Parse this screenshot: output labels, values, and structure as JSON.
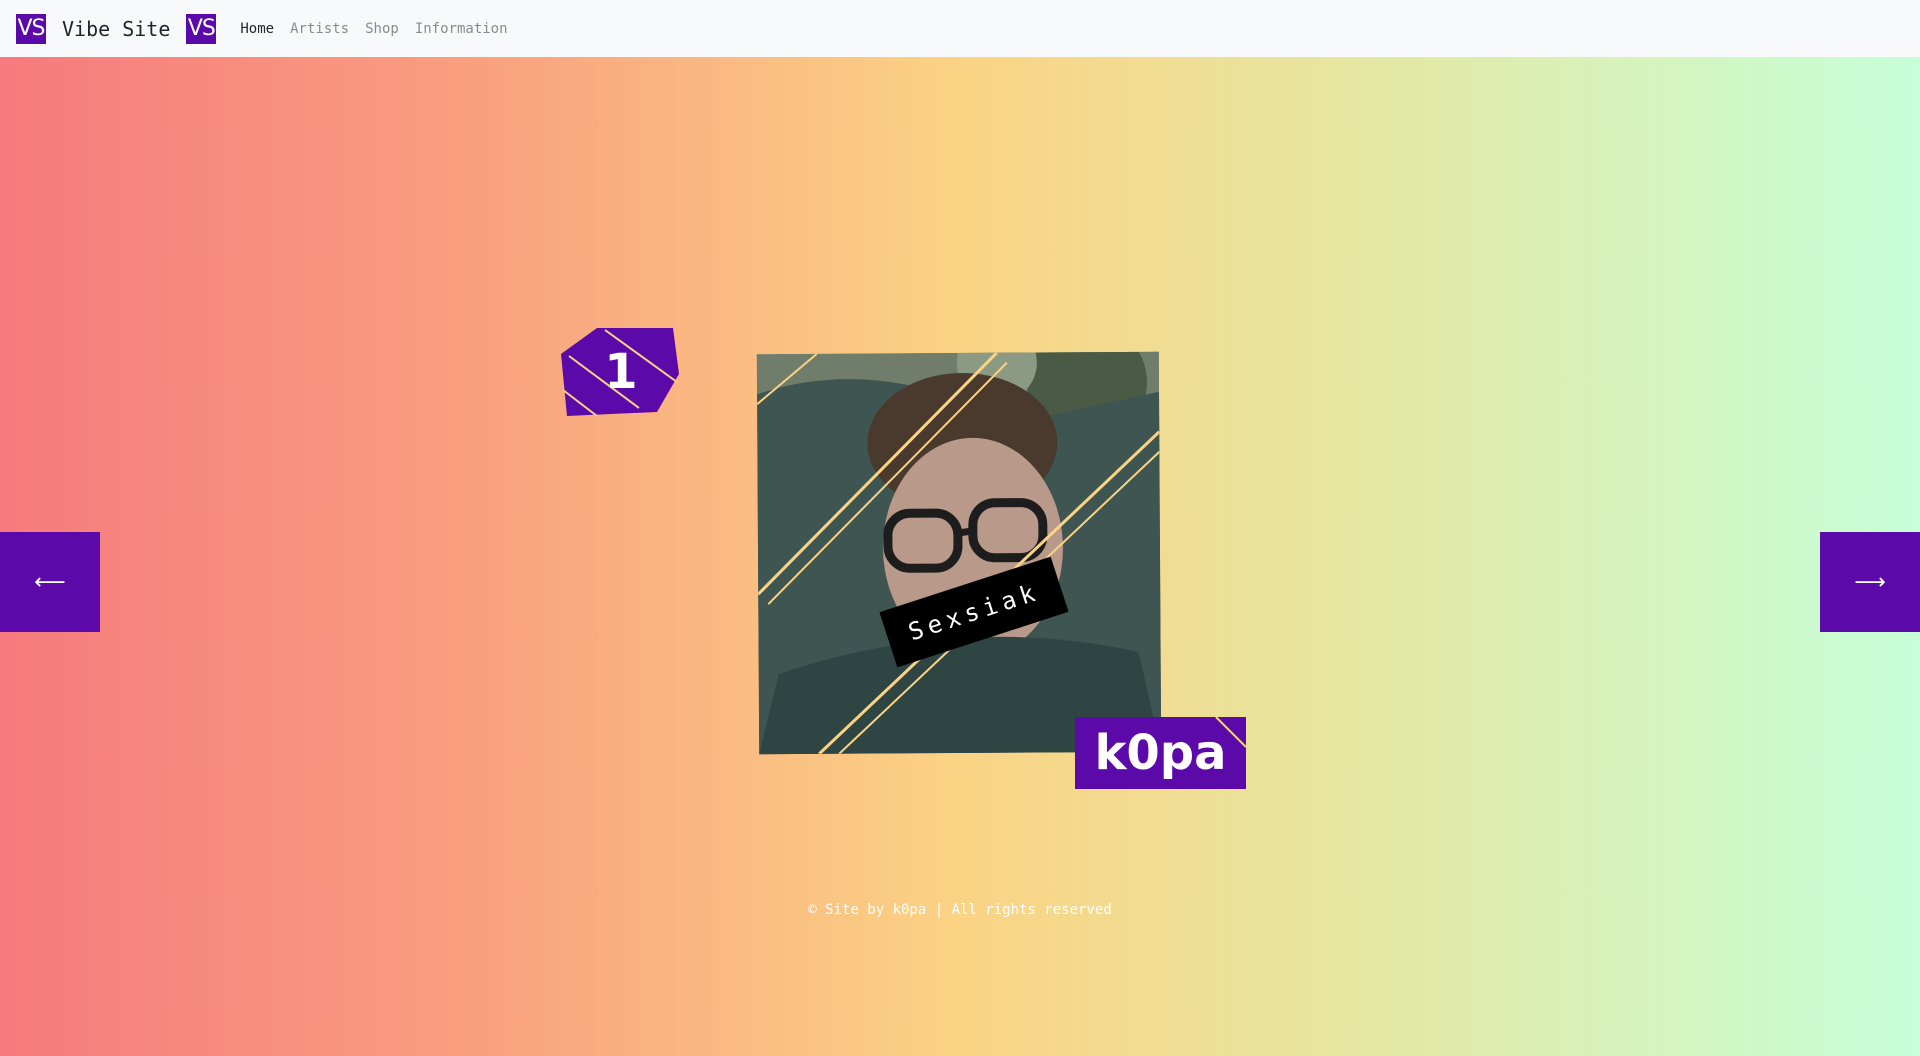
{
  "navbar": {
    "brand_logo_text": "VS",
    "brand_name": "Vibe Site",
    "links": [
      {
        "label": "Home",
        "active": true
      },
      {
        "label": "Artists",
        "active": false
      },
      {
        "label": "Shop",
        "active": false
      },
      {
        "label": "Information",
        "active": false
      }
    ]
  },
  "slide": {
    "rank": "1",
    "photo_tag": "Sexsiak",
    "artist_name": "k0pa",
    "prev_arrow": "⟵",
    "next_arrow": "⟶"
  },
  "footer": {
    "text": "© Site by k0pa | All rights reserved"
  },
  "colors": {
    "accent": "#5b0aa9",
    "stripe": "#fbd384",
    "gradient_left": "#f67a7e",
    "gradient_mid": "#fbd384",
    "gradient_right": "#c6ffd8",
    "navbar_bg": "#f8f9fa"
  }
}
